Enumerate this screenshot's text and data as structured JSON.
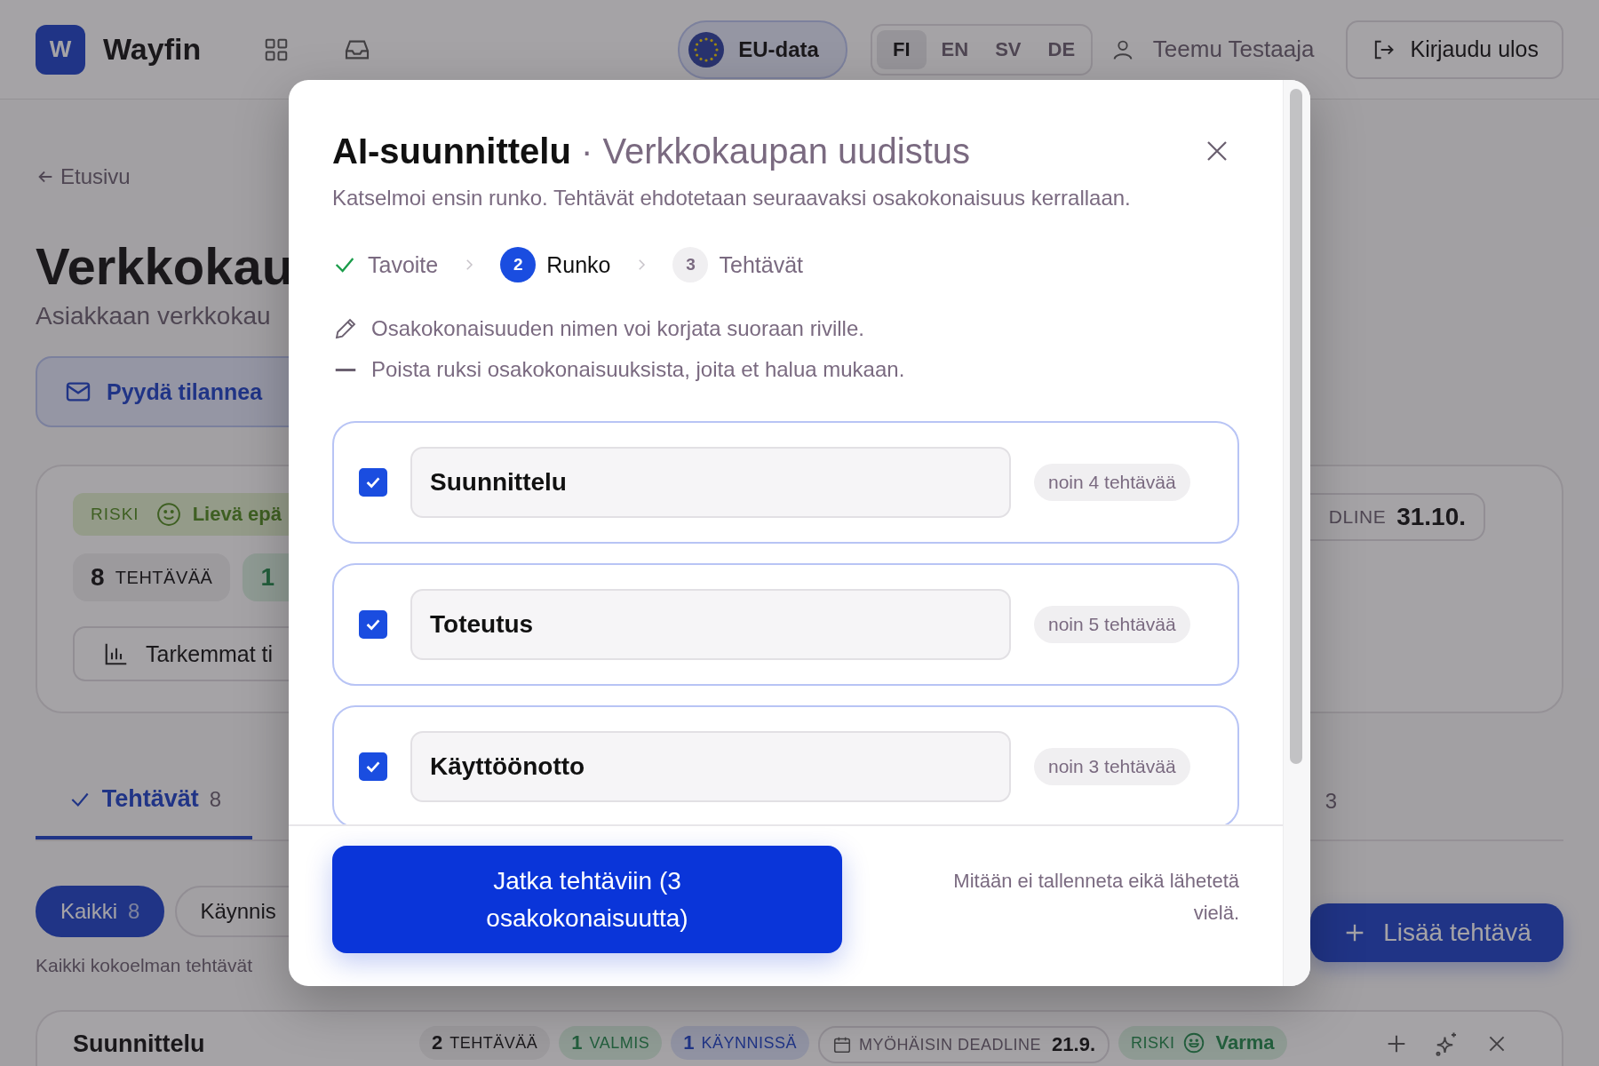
{
  "header": {
    "logo_letter": "W",
    "brand": "Wayfin",
    "eu_badge": "EU-data",
    "languages": [
      {
        "label": "FI",
        "selected": true
      },
      {
        "label": "EN",
        "selected": false
      },
      {
        "label": "SV",
        "selected": false
      },
      {
        "label": "DE",
        "selected": false
      }
    ],
    "user": "Teemu Testaaja",
    "logout": "Kirjaudu ulos"
  },
  "page": {
    "back": "Etusivu",
    "title": "Verkkokau",
    "subtitle": "Asiakkaan verkkokau",
    "request_button": "Pyydä tilannea",
    "summary": {
      "risk_label": "RISKI",
      "risk_value": "Lievä epä",
      "task_number": "8",
      "task_label": "TEHTÄVÄÄ",
      "done_number": "1",
      "details_button": "Tarkemmat ti",
      "deadline_label": "DLINE",
      "deadline_value": "31.10."
    },
    "tabs": [
      {
        "label": "Tehtävät",
        "count": "8",
        "selected": true
      },
      {
        "count": "3",
        "selected": false
      }
    ],
    "filters": [
      {
        "label": "Kaikki",
        "count": "8",
        "selected": true
      },
      {
        "label": "Käynnis",
        "selected": false
      }
    ],
    "filter_caption": "Kaikki kokoelman tehtävät",
    "add_button": "Lisää tehtävä",
    "group": {
      "title": "Suunnittelu",
      "chips": [
        {
          "kind": "count",
          "number": "2",
          "label": "TEHTÄVÄÄ"
        },
        {
          "kind": "done",
          "number": "1",
          "label": "VALMIS"
        },
        {
          "kind": "progress",
          "number": "1",
          "label": "KÄYNNISSÄ"
        },
        {
          "kind": "deadline",
          "label": "MYÖHÄISIN DEADLINE",
          "value": "21.9."
        },
        {
          "kind": "risk",
          "label": "RISKI",
          "value": "Varma"
        }
      ]
    }
  },
  "modal": {
    "title": "AI-suunnittelu",
    "separator": "·",
    "subtitle": "Verkkokaupan uudistus",
    "intro": "Katselmoi ensin runko. Tehtävät ehdotetaan seuraavaksi osakokonaisuus kerrallaan.",
    "steps": [
      {
        "label": "Tavoite",
        "completed": true,
        "selected": false
      },
      {
        "number": "2",
        "label": "Runko",
        "completed": false,
        "selected": true
      },
      {
        "number": "3",
        "label": "Tehtävät",
        "completed": false,
        "selected": false
      }
    ],
    "notes": [
      {
        "kind": "edit",
        "text": "Osakokonaisuuden nimen voi korjata suoraan riville."
      },
      {
        "kind": "remove",
        "text": "Poista ruksi osakokonaisuuksista, joita et halua mukaan."
      }
    ],
    "rows": [
      {
        "name": "Suunnittelu",
        "checked": true,
        "estimate": "noin 4 tehtävää"
      },
      {
        "name": "Toteutus",
        "checked": true,
        "estimate": "noin 5 tehtävää"
      },
      {
        "name": "Käyttöönotto",
        "checked": true,
        "estimate": "noin 3 tehtävää"
      }
    ],
    "continue_button": "Jatka tehtäviin (3 osakokonaisuutta)",
    "footnote": "Mitään ei tallenneta eikä lähetetä vielä."
  }
}
